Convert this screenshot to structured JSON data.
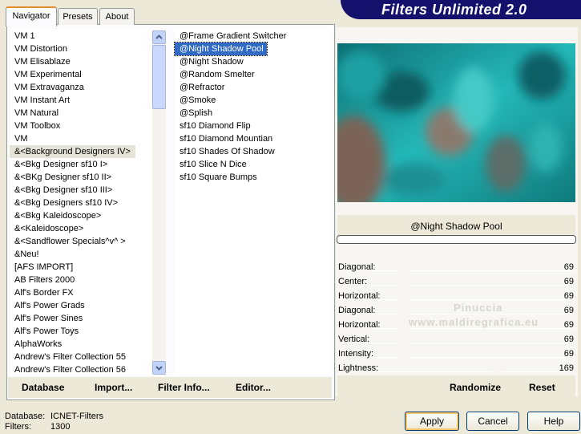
{
  "tabs": [
    {
      "label": "Navigator"
    },
    {
      "label": "Presets"
    },
    {
      "label": "About"
    }
  ],
  "banner": {
    "title": "Filters Unlimited 2.0"
  },
  "categories": [
    "VM 1",
    "VM Distortion",
    "VM Elisablaze",
    "VM Experimental",
    "VM Extravaganza",
    "VM Instant Art",
    "VM Natural",
    "VM Toolbox",
    "VM",
    "&<Background Designers IV>",
    "&<Bkg Designer sf10 I>",
    "&<BKg Designer sf10 II>",
    "&<Bkg Designer sf10 III>",
    "&<Bkg Designers sf10 IV>",
    "&<Bkg Kaleidoscope>",
    "&<Kaleidoscope>",
    "&<Sandflower Specials^v^ >",
    "&Neu!",
    "[AFS IMPORT]",
    "AB Filters 2000",
    "Alf's Border FX",
    "Alf's Power Grads",
    "Alf's Power Sines",
    "Alf's Power Toys",
    "AlphaWorks",
    "Andrew's Filter Collection 55",
    "Andrew's Filter Collection 56"
  ],
  "filters": [
    "@Frame Gradient Switcher",
    "@Night Shadow Pool",
    "@Night Shadow",
    "@Random Smelter",
    "@Refractor",
    "@Smoke",
    "@Splish",
    "sf10 Diamond Flip",
    "sf10 Diamond Mountian",
    "sf10 Shades Of Shadow",
    "sf10 Slice N Dice",
    "sf10 Square Bumps"
  ],
  "left_buttons": {
    "database": "Database",
    "import": "Import...",
    "filter_info": "Filter Info...",
    "editor": "Editor..."
  },
  "preview": {
    "filter_name": "@Night Shadow Pool",
    "watermark_line1": "Pinuccia",
    "watermark_line2": "www.maldiregrafica.eu",
    "progress": 0
  },
  "sliders": [
    {
      "label": "Diagonal:",
      "value": "69"
    },
    {
      "label": "Center:",
      "value": "69"
    },
    {
      "label": "Horizontal:",
      "value": "69"
    },
    {
      "label": "Diagonal:",
      "value": "69"
    },
    {
      "label": "Horizontal:",
      "value": "69"
    },
    {
      "label": "Vertical:",
      "value": "69"
    },
    {
      "label": "Intensity:",
      "value": "69"
    },
    {
      "label": "Lightness:",
      "value": "169"
    }
  ],
  "right_buttons": {
    "randomize": "Randomize",
    "reset": "Reset"
  },
  "status": {
    "database_label": "Database:",
    "database_value": "ICNET-Filters",
    "filters_label": "Filters:",
    "filters_value": "1300"
  },
  "dialog_buttons": {
    "apply": "Apply",
    "cancel": "Cancel",
    "help": "Help"
  }
}
